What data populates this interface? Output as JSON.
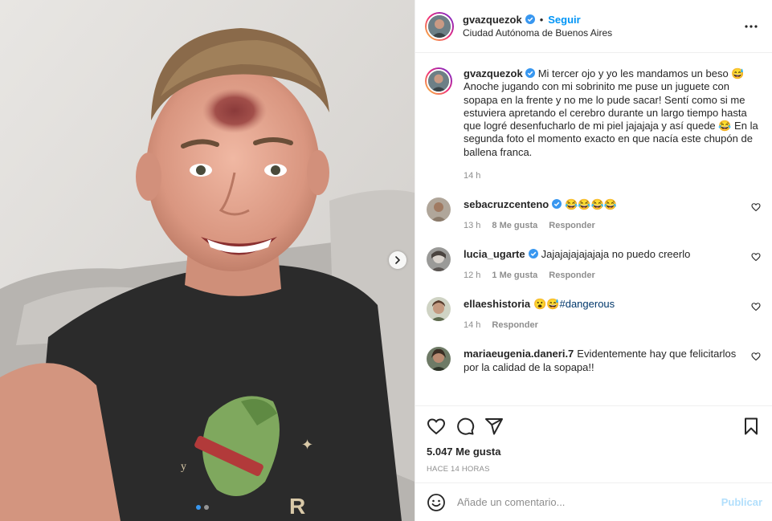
{
  "header": {
    "username": "gvazquezok",
    "separator": "•",
    "follow_label": "Seguir",
    "location": "Ciudad Autónoma de Buenos Aires"
  },
  "caption": {
    "username": "gvazquezok",
    "text": "Mi tercer ojo y yo les mandamos un beso 😅 Anoche jugando con mi sobrinito me puse un juguete con sopapa en la frente y no me lo pude sacar! Sentí como si me estuviera apretando el cerebro durante un largo tiempo hasta que logré desenfucharlo de mi piel jajajaja y así quede 😂 En la segunda foto el momento exacto en que nacía este chupón de ballena franca.",
    "time": "14 h"
  },
  "comments": [
    {
      "username": "sebacruzcenteno",
      "verified": true,
      "text": "😂😂😂😂",
      "hashtag": "",
      "time": "13 h",
      "likes": "8 Me gusta",
      "reply": "Responder"
    },
    {
      "username": "lucia_ugarte",
      "verified": true,
      "text": "Jajajajajajajaja no puedo creerlo",
      "hashtag": "",
      "time": "12 h",
      "likes": "1 Me gusta",
      "reply": "Responder"
    },
    {
      "username": "ellaeshistoria",
      "verified": false,
      "text": "😮😅",
      "hashtag": "#dangerous",
      "time": "14 h",
      "likes": "",
      "reply": "Responder"
    },
    {
      "username": "mariaeugenia.daneri.7",
      "verified": false,
      "text": "Evidentemente hay que felicitarlos por la calidad de la sopapa!!",
      "hashtag": "",
      "time": "",
      "likes": "",
      "reply": ""
    }
  ],
  "likes_count": "5.047 Me gusta",
  "posted_ago": "HACE 14 HORAS",
  "add_comment": {
    "placeholder": "Añade un comentario...",
    "publish_label": "Publicar"
  },
  "icons": {
    "verified": "verified-badge-icon",
    "more": "more-options-icon",
    "like": "heart-icon",
    "comment": "comment-icon",
    "share": "share-icon",
    "save": "bookmark-icon",
    "emoji": "emoji-icon",
    "next": "chevron-right-icon"
  },
  "colors": {
    "accent": "#0095f6",
    "publish_disabled": "#b2dffc",
    "muted": "#8e8e8e",
    "hashtag": "#00376b"
  }
}
